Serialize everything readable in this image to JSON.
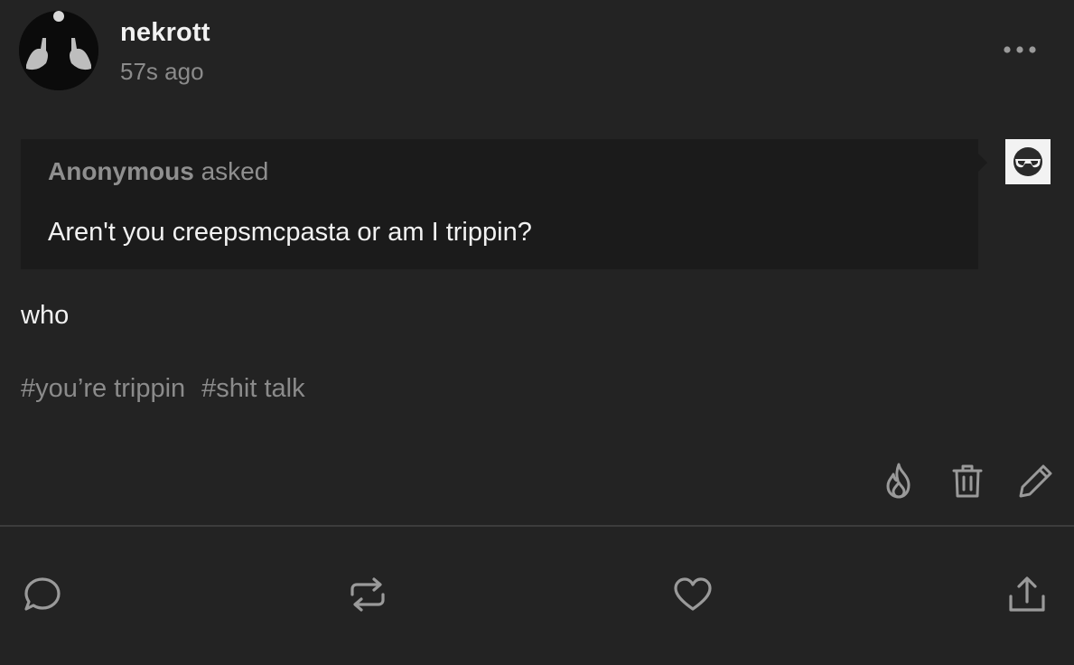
{
  "post": {
    "username": "nekrott",
    "timestamp": "57s ago",
    "more_icon": "more-horizontal-icon",
    "ask": {
      "asker": "Anonymous",
      "asked_word": "asked",
      "question": "Aren't you creepsmcpasta or am I trippin?"
    },
    "answer": "who",
    "tags": [
      "#you’re trippin",
      "#shit talk"
    ],
    "owner_actions": [
      "flame-icon",
      "trash-icon",
      "edit-icon"
    ],
    "footer_actions": [
      "reply-icon",
      "reblog-icon",
      "like-icon",
      "share-icon"
    ]
  },
  "colors": {
    "background": "#232323",
    "ask_background": "#1b1b1b",
    "text_primary": "#f2f2f2",
    "text_secondary": "#8b8b8b",
    "icon": "#9a9a9a",
    "divider": "#3c3c3c"
  }
}
